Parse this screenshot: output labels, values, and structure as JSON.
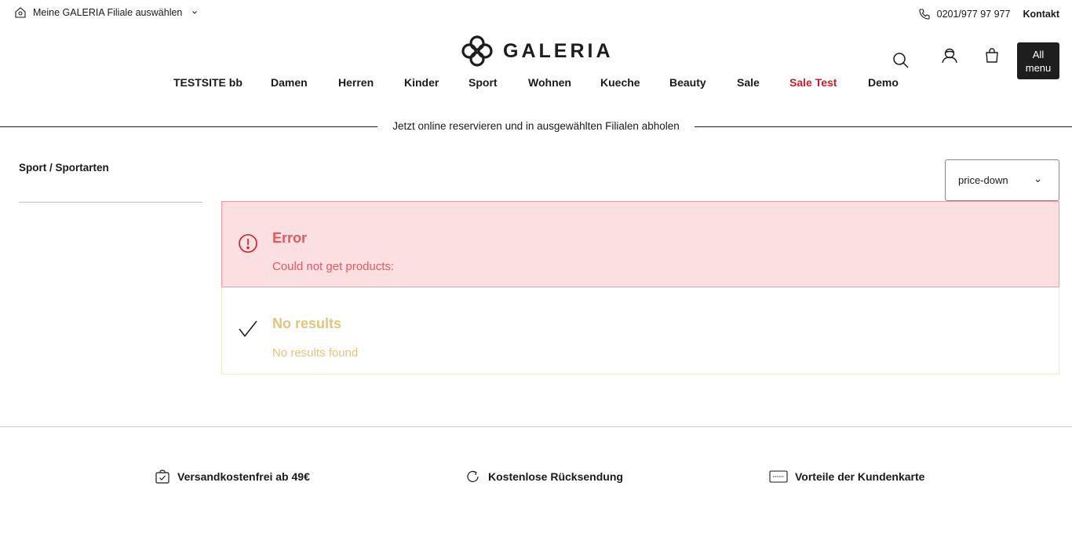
{
  "topbar": {
    "store_label": "Meine GALERIA Filiale auswählen",
    "phone": "0201/977 97 977",
    "contact_label": "Kontakt"
  },
  "logo": {
    "text": "GALERIA"
  },
  "header": {
    "all_menu_line1": "All",
    "all_menu_line2": "menu"
  },
  "nav": {
    "items": [
      {
        "label": "TESTSITE bb"
      },
      {
        "label": "Damen"
      },
      {
        "label": "Herren"
      },
      {
        "label": "Kinder"
      },
      {
        "label": "Sport"
      },
      {
        "label": "Wohnen"
      },
      {
        "label": "Kueche"
      },
      {
        "label": "Beauty"
      },
      {
        "label": "Sale"
      },
      {
        "label": "Sale Test",
        "highlight_color": "#d0182a"
      },
      {
        "label": "Demo"
      }
    ]
  },
  "promo": {
    "text": "Jetzt online reservieren und in ausgewählten Filialen abholen"
  },
  "breadcrumb": {
    "text": "Sport / Sportarten"
  },
  "sort": {
    "selected": "price-down"
  },
  "alerts": {
    "error": {
      "title": "Error",
      "message": "Could not get products:",
      "color": "#e05a62",
      "background": "#fcdfe0"
    },
    "info": {
      "title": "No results",
      "message": "No results found",
      "color": "#e2c47f"
    }
  },
  "footer": {
    "features": [
      {
        "label": "Versandkostenfrei ab 49€",
        "icon": "shipping-bag-icon"
      },
      {
        "label": "Kostenlose Rücksendung",
        "icon": "return-icon"
      },
      {
        "label": "Vorteile der Kundenkarte",
        "icon": "customer-card-icon"
      }
    ]
  }
}
